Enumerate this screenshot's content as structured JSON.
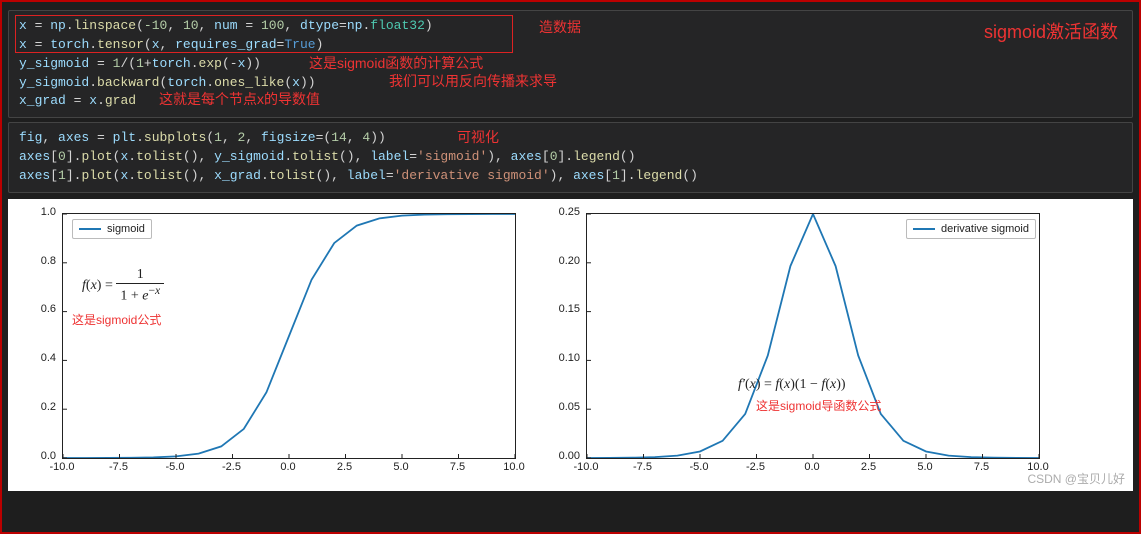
{
  "title": "sigmoid激活函数",
  "cell1": {
    "l1": {
      "a": "x",
      "b": "np",
      "c": "linspace",
      "d": "-10",
      "e": "10",
      "f": "num",
      "g": "100",
      "h": "dtype",
      "i": "np",
      "j": "float32"
    },
    "l2": {
      "a": "x",
      "b": "torch",
      "c": "tensor",
      "d": "x",
      "e": "requires_grad",
      "f": "True"
    },
    "l3": {
      "a": "y_sigmoid",
      "b": "1",
      "c": "1",
      "d": "torch",
      "e": "exp",
      "f": "x"
    },
    "l4": {
      "a": "y_sigmoid",
      "b": "backward",
      "c": "torch",
      "d": "ones_like",
      "e": "x"
    },
    "l5": {
      "a": "x_grad",
      "b": "x",
      "c": "grad"
    },
    "ann1": "造数据",
    "ann2": "这是sigmoid函数的计算公式",
    "ann3": "我们可以用反向传播来求导",
    "ann4": "这就是每个节点x的导数值"
  },
  "cell2": {
    "l1": {
      "a": "fig",
      "b": "axes",
      "c": "plt",
      "d": "subplots",
      "e": "1",
      "f": "2",
      "g": "figsize",
      "h": "14",
      "i": "4"
    },
    "l2": {
      "a": "axes",
      "b": "0",
      "c": "plot",
      "d": "x",
      "e": "tolist",
      "f": "y_sigmoid",
      "g": "tolist",
      "h": "label",
      "i": "'sigmoid'",
      "j": "axes",
      "k": "0",
      "l": "legend"
    },
    "l3": {
      "a": "axes",
      "b": "1",
      "c": "plot",
      "d": "x",
      "e": "tolist",
      "f": "x_grad",
      "g": "tolist",
      "h": "label",
      "i": "'derivative sigmoid'",
      "j": "axes",
      "k": "1",
      "l": "legend"
    },
    "ann1": "可视化"
  },
  "chart_data": [
    {
      "type": "line",
      "title": "",
      "legend": "sigmoid",
      "xlabel": "",
      "ylabel": "",
      "xlim": [
        -10,
        10
      ],
      "ylim": [
        0,
        1
      ],
      "xticks": [
        -10,
        -7.5,
        -5,
        -2.5,
        0,
        2.5,
        5,
        7.5,
        10
      ],
      "yticks": [
        0,
        0.2,
        0.4,
        0.6,
        0.8,
        1.0
      ],
      "xtick_labels": [
        "-10.0",
        "-7.5",
        "-5.0",
        "-2.5",
        "0.0",
        "2.5",
        "5.0",
        "7.5",
        "10.0"
      ],
      "ytick_labels": [
        "0.0",
        "0.2",
        "0.4",
        "0.6",
        "0.8",
        "1.0"
      ],
      "formula": "f(x) = 1 / (1 + e^{-x})",
      "annotation": "这是sigmoid公式",
      "series": [
        {
          "name": "sigmoid",
          "x": [
            -10,
            -9,
            -8,
            -7,
            -6,
            -5,
            -4,
            -3,
            -2,
            -1,
            0,
            1,
            2,
            3,
            4,
            5,
            6,
            7,
            8,
            9,
            10
          ],
          "y": [
            4.5e-05,
            0.000123,
            0.000335,
            0.000911,
            0.002473,
            0.006693,
            0.017986,
            0.047426,
            0.119203,
            0.268941,
            0.5,
            0.731059,
            0.880797,
            0.952574,
            0.982014,
            0.993307,
            0.997527,
            0.999089,
            0.999665,
            0.999877,
            0.999955
          ]
        }
      ]
    },
    {
      "type": "line",
      "title": "",
      "legend": "derivative sigmoid",
      "xlabel": "",
      "ylabel": "",
      "xlim": [
        -10,
        10
      ],
      "ylim": [
        0,
        0.25
      ],
      "xticks": [
        -10,
        -7.5,
        -5,
        -2.5,
        0,
        2.5,
        5,
        7.5,
        10
      ],
      "yticks": [
        0,
        0.05,
        0.1,
        0.15,
        0.2,
        0.25
      ],
      "xtick_labels": [
        "-10.0",
        "-7.5",
        "-5.0",
        "-2.5",
        "0.0",
        "2.5",
        "5.0",
        "7.5",
        "10.0"
      ],
      "ytick_labels": [
        "0.00",
        "0.05",
        "0.10",
        "0.15",
        "0.20",
        "0.25"
      ],
      "formula": "f'(x) = f(x)(1 - f(x))",
      "annotation": "这是sigmoid导函数公式",
      "series": [
        {
          "name": "derivative sigmoid",
          "x": [
            -10,
            -9,
            -8,
            -7,
            -6,
            -5,
            -4,
            -3,
            -2,
            -1,
            0,
            1,
            2,
            3,
            4,
            5,
            6,
            7,
            8,
            9,
            10
          ],
          "y": [
            4.5e-05,
            0.000123,
            0.000335,
            0.00091,
            0.002467,
            0.006648,
            0.017663,
            0.045177,
            0.104994,
            0.196612,
            0.25,
            0.196612,
            0.104994,
            0.045177,
            0.017663,
            0.006648,
            0.002467,
            0.00091,
            0.000335,
            0.000123,
            4.5e-05
          ]
        }
      ]
    }
  ],
  "watermark": "CSDN @宝贝儿好"
}
